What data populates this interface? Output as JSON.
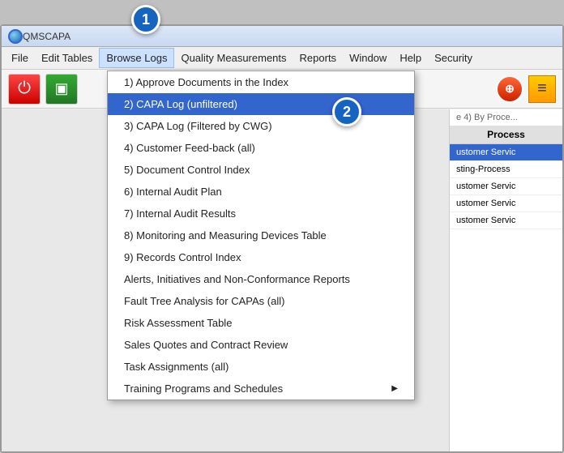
{
  "app": {
    "title": "QMSCAPA",
    "step1_label": "1",
    "step2_label": "2"
  },
  "title_bar": {
    "text": "QMSCAPA"
  },
  "menu_bar": {
    "items": [
      {
        "id": "file",
        "label": "File"
      },
      {
        "id": "edit-tables",
        "label": "Edit Tables"
      },
      {
        "id": "browse-logs",
        "label": "Browse Logs",
        "active": true
      },
      {
        "id": "quality-measurements",
        "label": "Quality Measurements"
      },
      {
        "id": "reports",
        "label": "Reports"
      },
      {
        "id": "window",
        "label": "Window"
      },
      {
        "id": "help",
        "label": "Help"
      },
      {
        "id": "security",
        "label": "Security"
      }
    ]
  },
  "dropdown": {
    "items": [
      {
        "id": "item1",
        "label": "1) Approve Documents in the Index",
        "selected": false
      },
      {
        "id": "item2",
        "label": "2) CAPA Log (unfiltered)",
        "selected": true
      },
      {
        "id": "item3",
        "label": "3) CAPA Log (Filtered by CWG)",
        "selected": false
      },
      {
        "id": "item4",
        "label": "4) Customer Feed-back (all)",
        "selected": false
      },
      {
        "id": "item5",
        "label": "5) Document Control Index",
        "selected": false
      },
      {
        "id": "item6",
        "label": "6) Internal Audit Plan",
        "selected": false
      },
      {
        "id": "item7",
        "label": "7) Internal Audit Results",
        "selected": false
      },
      {
        "id": "item8",
        "label": "8) Monitoring and Measuring Devices Table",
        "selected": false
      },
      {
        "id": "item9",
        "label": "9) Records Control Index",
        "selected": false
      },
      {
        "id": "item-alerts",
        "label": "Alerts, Initiatives and Non-Conformance Reports",
        "selected": false
      },
      {
        "id": "item-fault",
        "label": "Fault Tree Analysis for CAPAs (all)",
        "selected": false
      },
      {
        "id": "item-risk",
        "label": "Risk Assessment Table",
        "selected": false
      },
      {
        "id": "item-sales",
        "label": "Sales Quotes and Contract Review",
        "selected": false
      },
      {
        "id": "item-task",
        "label": "Task Assignments (all)",
        "selected": false
      },
      {
        "id": "item-training",
        "label": "Training Programs and Schedules",
        "selected": false,
        "has_arrow": true
      }
    ]
  },
  "right_panel": {
    "header": "Process",
    "by_process_label": "e  4) By Proce...",
    "items": [
      {
        "label": "ustomer Servic",
        "blue": true
      },
      {
        "label": "sting-Process"
      },
      {
        "label": "ustomer Servic"
      },
      {
        "label": "ustomer Servic"
      },
      {
        "label": "ustomer Servic"
      }
    ]
  }
}
